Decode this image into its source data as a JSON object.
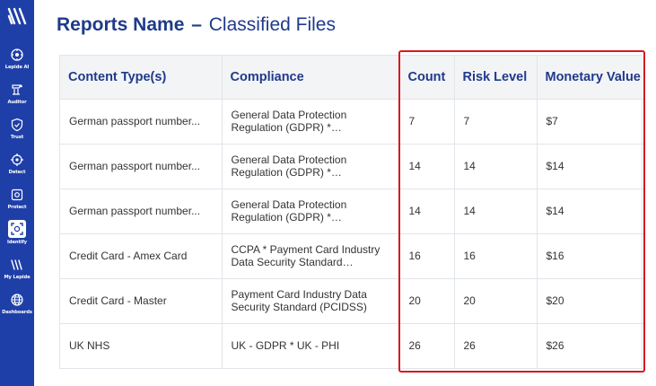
{
  "sidebar": {
    "logo_icon": "lepide-logo-icon",
    "items": [
      {
        "label": "Lepide AI",
        "icon": "ai-brain-icon"
      },
      {
        "label": "Auditor",
        "icon": "auditor-icon"
      },
      {
        "label": "Trust",
        "icon": "shield-check-icon"
      },
      {
        "label": "Detect",
        "icon": "crosshair-icon"
      },
      {
        "label": "Protect",
        "icon": "protect-icon"
      },
      {
        "label": "Identify",
        "icon": "identify-icon"
      },
      {
        "label": "My Lepide",
        "icon": "my-lepide-icon"
      },
      {
        "label": "Dashboards",
        "icon": "globe-icon"
      }
    ],
    "active": "Identify",
    "bg_color": "#1f3fa8"
  },
  "header": {
    "title_bold": "Reports Name",
    "title_sep": "–",
    "title_rest": "Classified Files",
    "color": "#1f3a8a"
  },
  "table": {
    "columns": [
      "Content Type(s)",
      "Compliance",
      "Count",
      "Risk Level",
      "Monetary Value"
    ],
    "rows": [
      {
        "content_type": "German passport number...",
        "compliance": "General Data Protection Regulation (GDPR) * Personally...",
        "count": "7",
        "risk_level": "7",
        "monetary_value": "$7"
      },
      {
        "content_type": "German passport number...",
        "compliance": "General Data Protection Regulation (GDPR) * Personally...",
        "count": "14",
        "risk_level": "14",
        "monetary_value": "$14"
      },
      {
        "content_type": "German passport number...",
        "compliance": "General Data Protection Regulation (GDPR) * Personally...",
        "count": "14",
        "risk_level": "14",
        "monetary_value": "$14"
      },
      {
        "content_type": "Credit Card - Amex Card",
        "compliance": "CCPA * Payment Card Industry Data Security Standard (PCIDSS)",
        "count": "16",
        "risk_level": "16",
        "monetary_value": "$16"
      },
      {
        "content_type": "Credit Card - Master",
        "compliance": "Payment Card Industry Data Security Standard (PCIDSS)",
        "count": "20",
        "risk_level": "20",
        "monetary_value": "$20"
      },
      {
        "content_type": "UK NHS",
        "compliance": "UK - GDPR * UK - PHI",
        "count": "26",
        "risk_level": "26",
        "monetary_value": "$26"
      }
    ]
  },
  "highlight_color": "#d71920"
}
